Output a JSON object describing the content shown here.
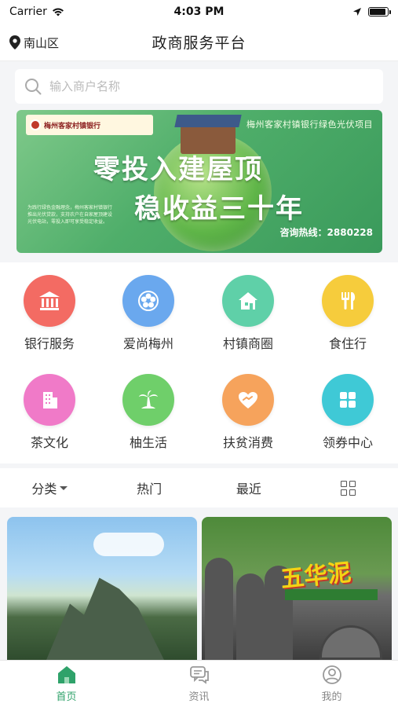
{
  "status_bar": {
    "carrier": "Carrier",
    "time": "4:03 PM",
    "battery_level": 0.9
  },
  "header": {
    "location": "南山区",
    "title": "政商服务平台"
  },
  "search": {
    "placeholder": "输入商户名称",
    "value": ""
  },
  "banner": {
    "bank_name": "梅州客家村镇银行",
    "subtitle": "梅州客家村镇银行绿色光伏项目",
    "headline_1": "零投入建屋顶",
    "headline_2": "稳收益三十年",
    "description": "为践行绿色金融理念，梅州客家村镇银行推出光伏贷款，支持农户在自家屋顶建设光伏电站，零投入即可享受稳定收益。",
    "hotline": "咨询热线：2880228"
  },
  "categories": [
    {
      "label": "银行服务",
      "icon": "bank-icon",
      "color": "#f36b63"
    },
    {
      "label": "爱尚梅州",
      "icon": "plum-flower-icon",
      "color": "#6aa8ee"
    },
    {
      "label": "村镇商圈",
      "icon": "village-shop-icon",
      "color": "#5fd0a8"
    },
    {
      "label": "食住行",
      "icon": "dining-icon",
      "color": "#f6cc3c"
    },
    {
      "label": "茶文化",
      "icon": "building-icon",
      "color": "#f07ac8"
    },
    {
      "label": "柚生活",
      "icon": "palm-tree-icon",
      "color": "#6fcf6a"
    },
    {
      "label": "扶贫消费",
      "icon": "heart-hands-icon",
      "color": "#f6a35c"
    },
    {
      "label": "领券中心",
      "icon": "coupon-grid-icon",
      "color": "#3fc9d6"
    }
  ],
  "filters": {
    "category": "分类",
    "hot": "热门",
    "recent": "最近"
  },
  "tab_bar": [
    {
      "label": "首页",
      "icon": "home-icon",
      "active": true
    },
    {
      "label": "资讯",
      "icon": "chat-icon",
      "active": false
    },
    {
      "label": "我的",
      "icon": "profile-icon",
      "active": false
    }
  ],
  "colors": {
    "accent": "#2fa26a",
    "page_bg": "#f4f5f7"
  }
}
